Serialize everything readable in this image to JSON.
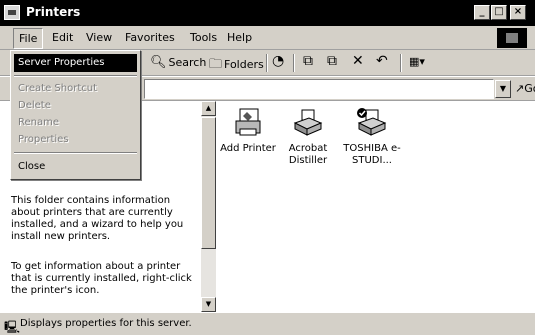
{
  "window": {
    "title": "Printers",
    "icon": "printer-folder-icon"
  },
  "titlebar_buttons": {
    "minimize": "_",
    "maximize": "□",
    "close": "×"
  },
  "menubar": {
    "items": [
      "File",
      "Edit",
      "View",
      "Favorites",
      "Tools",
      "Help"
    ]
  },
  "file_menu": {
    "server_properties": "Server Properties",
    "create_shortcut": "Create Shortcut",
    "delete": "Delete",
    "rename": "Rename",
    "properties": "Properties",
    "close": "Close"
  },
  "toolbar": {
    "search": "Search",
    "folders": "Folders",
    "views_glyph": "▦▾"
  },
  "address_bar": {
    "value": "",
    "go": "Go"
  },
  "info_pane": {
    "paragraph1": "This folder contains information about printers that are currently installed, and a wizard to help you install new printers.",
    "paragraph2": "To get information about a printer that is currently installed, right-click the printer's icon."
  },
  "printers": [
    {
      "name": "Add Printer",
      "icon": "add-printer-icon"
    },
    {
      "name": "Acrobat Distiller",
      "icon": "printer-icon"
    },
    {
      "name": "TOSHIBA e-STUDI...",
      "icon": "default-printer-icon"
    }
  ],
  "status_bar": {
    "text": "Displays properties for this server."
  }
}
